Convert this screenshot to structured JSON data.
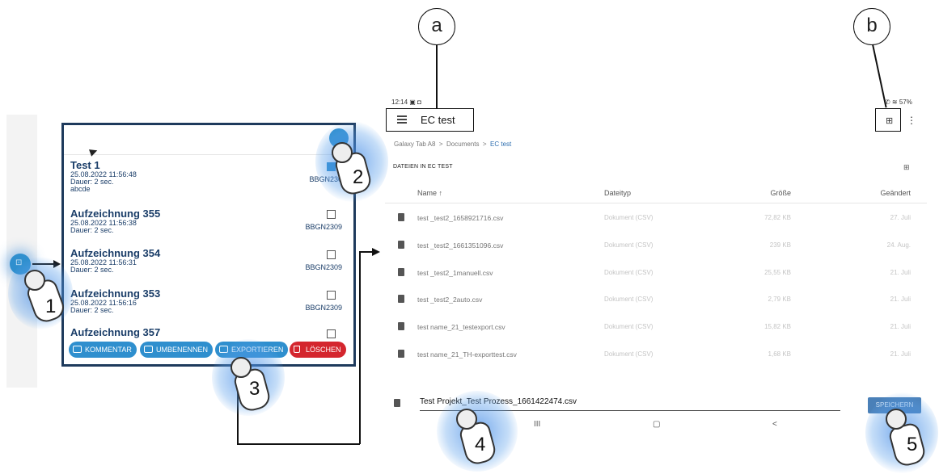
{
  "left_panel": {
    "fab_glyph": "⊡",
    "records": [
      {
        "title": "Test 1",
        "date": "25.08.2022 11:56:48",
        "duration": "Dauer: 2 sec.",
        "comment": "abcde",
        "code": "BBGN230",
        "checked": true
      },
      {
        "title": "Aufzeichnung 355",
        "date": "25.08.2022 11:56:38",
        "duration": "Dauer: 2 sec.",
        "comment": "",
        "code": "BBGN2309",
        "checked": false
      },
      {
        "title": "Aufzeichnung 354",
        "date": "25.08.2022 11:56:31",
        "duration": "Dauer: 2 sec.",
        "comment": "",
        "code": "BBGN2309",
        "checked": false
      },
      {
        "title": "Aufzeichnung 353",
        "date": "25.08.2022 11:56:16",
        "duration": "Dauer: 2 sec.",
        "comment": "",
        "code": "BBGN2309",
        "checked": false
      },
      {
        "title": "Aufzeichnung 357",
        "date": "",
        "duration": "",
        "comment": "",
        "code": "",
        "checked": false
      }
    ],
    "buttons": {
      "comment": "KOMMENTAR",
      "rename": "UMBENENNEN",
      "export": "EXPORTIEREN",
      "delete": "LÖSCHEN"
    }
  },
  "callouts": {
    "step1": "1",
    "step2": "2",
    "step3": "3",
    "step4": "4",
    "step5": "5",
    "label_a": "a",
    "label_b": "b"
  },
  "tablet": {
    "status_time": "12:14",
    "status_right": "57%",
    "title": "EC test",
    "breadcrumb": {
      "device": "Galaxy Tab A8",
      "folder": "Documents",
      "current": "EC test"
    },
    "section_title": "DATEIEN IN EC TEST",
    "columns": {
      "name": "Name ↑",
      "type": "Dateityp",
      "size": "Größe",
      "modified": "Geändert"
    },
    "files": [
      {
        "name": "test _test2_1658921716.csv",
        "type": "Dokument (CSV)",
        "size": "72,82 KB",
        "modified": "27. Juli"
      },
      {
        "name": "test _test2_1661351096.csv",
        "type": "Dokument (CSV)",
        "size": "239 KB",
        "modified": "24. Aug."
      },
      {
        "name": "test _test2_1manuell.csv",
        "type": "Dokument (CSV)",
        "size": "25,55 KB",
        "modified": "21. Juli"
      },
      {
        "name": "test _test2_2auto.csv",
        "type": "Dokument (CSV)",
        "size": "2,79 KB",
        "modified": "21. Juli"
      },
      {
        "name": "test name_21_testexport.csv",
        "type": "Dokument (CSV)",
        "size": "15,82 KB",
        "modified": "21. Juli"
      },
      {
        "name": "test name_21_TH-exporttest.csv",
        "type": "Dokument (CSV)",
        "size": "1,68 KB",
        "modified": "21. Juli"
      }
    ],
    "save_filename": "Test Projekt_Test Prozess_1661422474.csv",
    "save_button": "SPEICHERN",
    "nav": {
      "recents": "III",
      "home": "▢",
      "back": "<"
    }
  }
}
